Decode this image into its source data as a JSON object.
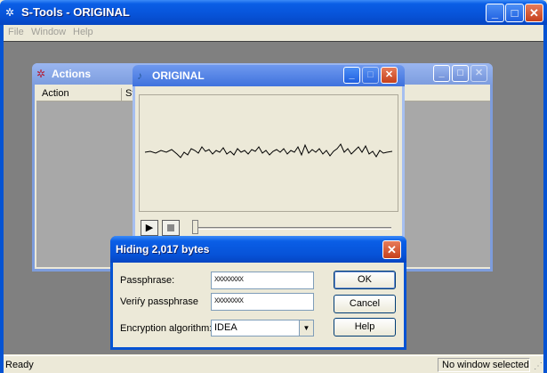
{
  "app": {
    "title": "S-Tools - ORIGINAL",
    "title_icon": "s-tools-logo-icon"
  },
  "menu": {
    "items": [
      {
        "label": "File"
      },
      {
        "label": "Window"
      },
      {
        "label": "Help"
      }
    ]
  },
  "actions_window": {
    "title": "Actions",
    "columns": [
      {
        "label": "Action"
      },
      {
        "label": "St"
      }
    ]
  },
  "original_window": {
    "title": "ORIGINAL",
    "play_icon": "play-icon",
    "stop_icon": "stop-icon"
  },
  "dialog": {
    "title": "Hiding 2,017 bytes",
    "passphrase_label": "Passphrase:",
    "passphrase_value": "xxxxxxxx",
    "verify_label": "Veriŕy passphrase",
    "verify_value": "xxxxxxxx",
    "algorithm_label": "Encryption algorithm:",
    "algorithm_value": "IDEA",
    "ok_label": "OK",
    "cancel_label": "Cancel",
    "help_label": "Help"
  },
  "status": {
    "left": "Ready",
    "right": "No window selected"
  },
  "colors": {
    "active_title": "#0a5ee6",
    "inactive_title": "#7d9ddf",
    "mdi_background": "#808080"
  }
}
